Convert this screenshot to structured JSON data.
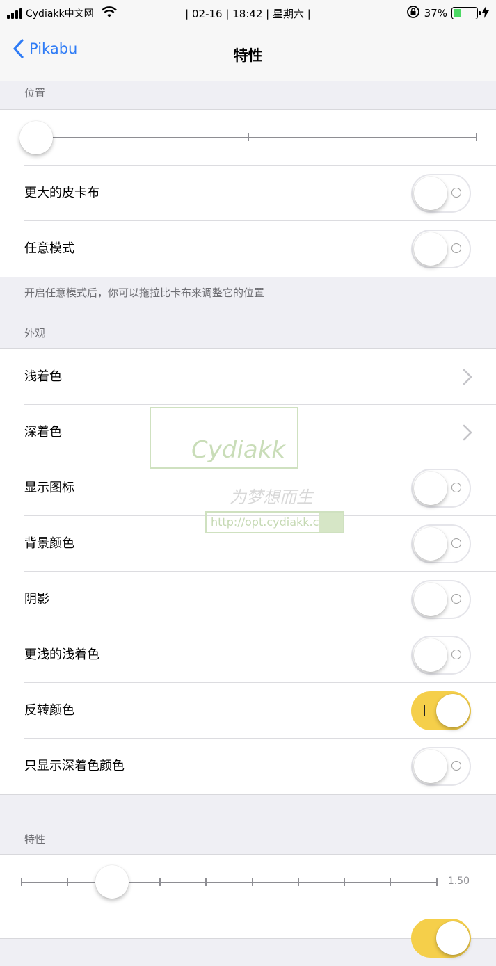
{
  "status_bar": {
    "carrier": "Cydiakk中文网",
    "center": "| 02-16 | 18:42 | 星期六 |",
    "battery_percent_text": "37%",
    "battery_level": 0.37
  },
  "nav": {
    "back_label": "Pikabu",
    "title": "特性"
  },
  "sections": {
    "position_header": "位置",
    "position_footer": "开启任意模式后，你可以拖拉比卡布来调整它的位置",
    "appearance_header": "外观",
    "features_header": "特性"
  },
  "position_rows": {
    "bigger_pikabu": {
      "label": "更大的皮卡布",
      "on": false
    },
    "free_mode": {
      "label": "任意模式",
      "on": false
    }
  },
  "position_slider": {
    "value_fraction": 0.0,
    "ticks": 3
  },
  "appearance_rows": {
    "light_tint": {
      "label": "浅着色"
    },
    "dark_tint": {
      "label": "深着色"
    },
    "show_icon": {
      "label": "显示图标",
      "on": false
    },
    "background_color": {
      "label": "背景颜色",
      "on": false
    },
    "shadow": {
      "label": "阴影",
      "on": false
    },
    "lighter_light_tint": {
      "label": "更浅的浅着色",
      "on": false
    },
    "invert_colors": {
      "label": "反转颜色",
      "on": true
    },
    "only_dark_tint": {
      "label": "只显示深着色颜色",
      "on": false
    }
  },
  "features_slider": {
    "value_text": "1.50",
    "value_fraction": 0.22,
    "ticks": 10
  },
  "watermark": {
    "brand": "Cydiakk",
    "slogan": "为梦想而生",
    "url": "http://opt.cydiakk.com"
  },
  "colors": {
    "accent": "#2f7cf6",
    "toggle_on": "#f5cf4a",
    "background": "#efeff4"
  }
}
